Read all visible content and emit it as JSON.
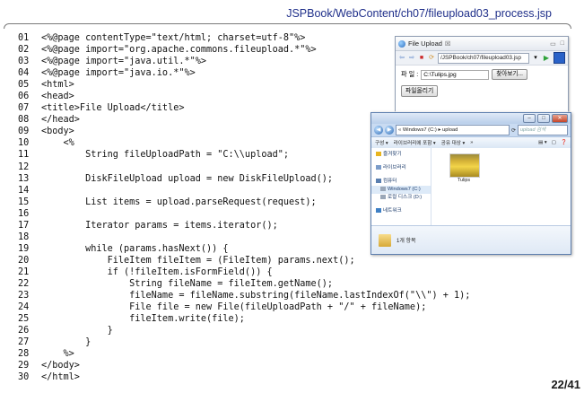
{
  "header": {
    "path": "JSPBook/WebContent/ch07/fileupload03_process.jsp"
  },
  "code_lines": [
    {
      "num": "01",
      "text": "<%@page contentType=\"text/html; charset=utf-8\"%>"
    },
    {
      "num": "02",
      "text": "<%@page import=\"org.apache.commons.fileupload.*\"%>"
    },
    {
      "num": "03",
      "text": "<%@page import=\"java.util.*\"%>"
    },
    {
      "num": "04",
      "text": "<%@page import=\"java.io.*\"%>"
    },
    {
      "num": "05",
      "text": "<html>"
    },
    {
      "num": "06",
      "text": "<head>"
    },
    {
      "num": "07",
      "text": "<title>File Upload</title>"
    },
    {
      "num": "08",
      "text": "</head>"
    },
    {
      "num": "09",
      "text": "<body>"
    },
    {
      "num": "10",
      "text": "    <%"
    },
    {
      "num": "11",
      "text": "        String fileUploadPath = \"C:\\\\upload\";"
    },
    {
      "num": "12",
      "text": ""
    },
    {
      "num": "13",
      "text": "        DiskFileUpload upload = new DiskFileUpload();"
    },
    {
      "num": "14",
      "text": ""
    },
    {
      "num": "15",
      "text": "        List items = upload.parseRequest(request);"
    },
    {
      "num": "16",
      "text": ""
    },
    {
      "num": "17",
      "text": "        Iterator params = items.iterator();"
    },
    {
      "num": "18",
      "text": ""
    },
    {
      "num": "19",
      "text": "        while (params.hasNext()) {"
    },
    {
      "num": "20",
      "text": "            FileItem fileItem = (FileItem) params.next();"
    },
    {
      "num": "21",
      "text": "            if (!fileItem.isFormField()) {"
    },
    {
      "num": "22",
      "text": "                String fileName = fileItem.getName();"
    },
    {
      "num": "23",
      "text": "                fileName = fileName.substring(fileName.lastIndexOf(\"\\\\\") + 1);"
    },
    {
      "num": "24",
      "text": "                File file = new File(fileUploadPath + \"/\" + fileName);"
    },
    {
      "num": "25",
      "text": "                fileItem.write(file);"
    },
    {
      "num": "26",
      "text": "            }"
    },
    {
      "num": "27",
      "text": "        }"
    },
    {
      "num": "28",
      "text": "    %>"
    },
    {
      "num": "29",
      "text": "</body>"
    },
    {
      "num": "30",
      "text": "</html>"
    }
  ],
  "browser": {
    "tab_title": "File Upload",
    "tab_close": "☒",
    "url": "/JSPBook/ch07/fileupload03.jsp",
    "file_label": "파 일 :",
    "file_value": "C:\\Tulips.jpg",
    "browse_label": "찾아보기...",
    "upload_label": "파일올리기"
  },
  "explorer": {
    "address": "« Windows7 (C:) ▸ upload",
    "search_placeholder": "upload 검색",
    "commands": [
      "구성 ▾",
      "라이브러리에 포함 ▾",
      "공유 대상 ▾",
      "»"
    ],
    "nav_items": [
      {
        "label": "즐겨찾기",
        "icon": "star-icon"
      },
      {
        "label": "라이브러리",
        "icon": "library-icon"
      },
      {
        "label": "컴퓨터",
        "icon": "computer-icon"
      },
      {
        "label": "Windows7 (C:)",
        "icon": "drive-icon"
      },
      {
        "label": "로컬 디스크 (D:)",
        "icon": "drive-icon"
      },
      {
        "label": "네트워크",
        "icon": "network-icon"
      }
    ],
    "file_name": "Tulips",
    "item_count": "1개 항목"
  },
  "page_number": "22/41"
}
